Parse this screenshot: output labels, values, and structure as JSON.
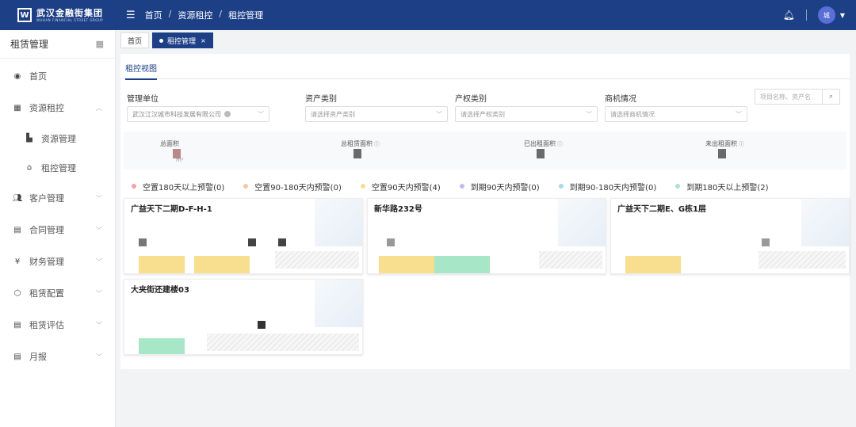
{
  "header": {
    "logo_mark": "W",
    "logo_cn": "武汉金融街集团",
    "logo_en": "WUHAN FINANCIAL STREET GROUP",
    "menu_icon": "menu-fold-icon",
    "breadcrumb": [
      "首页",
      "资源租控",
      "租控管理"
    ],
    "separator": "/",
    "avatar_text": "城"
  },
  "sidebar": {
    "title": "租赁管理",
    "items": [
      {
        "label": "首页",
        "icon": "dashboard-icon"
      },
      {
        "label": "资源租控",
        "icon": "grid-icon",
        "expanded": true
      },
      {
        "label": "资源管理",
        "icon": "building-icon",
        "sub": true
      },
      {
        "label": "租控管理",
        "icon": "home-icon",
        "sub": true
      },
      {
        "label": "客户管理",
        "icon": "users-icon"
      },
      {
        "label": "合同管理",
        "icon": "contract-icon"
      },
      {
        "label": "财务管理",
        "icon": "yen-icon"
      },
      {
        "label": "租赁配置",
        "icon": "cube-icon"
      },
      {
        "label": "租赁评估",
        "icon": "evaluation-icon"
      },
      {
        "label": "月报",
        "icon": "report-icon"
      }
    ]
  },
  "tabs": [
    {
      "label": "首页",
      "active": false
    },
    {
      "label": "租控管理",
      "active": true
    }
  ],
  "view_tab": "租控视图",
  "filters": {
    "unit_label": "管理单位",
    "unit_value": "武汉江汉城市科技发展有限公司",
    "asset_label": "资产类别",
    "asset_placeholder": "请选择资产类别",
    "right_label": "产权类别",
    "right_placeholder": "请选择产权类别",
    "biz_label": "商机情况",
    "biz_placeholder": "请选择商机情况",
    "search_placeholder": "项目名称、资产名"
  },
  "stats": [
    {
      "label": "总面积",
      "unit": "m²"
    },
    {
      "label": "总租赁面积"
    },
    {
      "label": "已出租面积"
    },
    {
      "label": "未出租面积"
    }
  ],
  "legend": [
    {
      "label": "空置180天以上预警(0)",
      "color": "#f4a3a8"
    },
    {
      "label": "空置90-180天内预警(0)",
      "color": "#f6c89e"
    },
    {
      "label": "空置90天内预警(4)",
      "color": "#f7df8f"
    },
    {
      "label": "到期90天内预警(0)",
      "color": "#c7b8e8"
    },
    {
      "label": "到期90-180天内预警(0)",
      "color": "#a8d8ea"
    },
    {
      "label": "到期180天以上预警(2)",
      "color": "#a8e6c8"
    }
  ],
  "cards": [
    {
      "title": "广益天下二期D-F-H-1"
    },
    {
      "title": "新华路232号"
    },
    {
      "title": "广益天下二期E、G栋1层"
    },
    {
      "title": "大夹街还建楼03"
    }
  ]
}
